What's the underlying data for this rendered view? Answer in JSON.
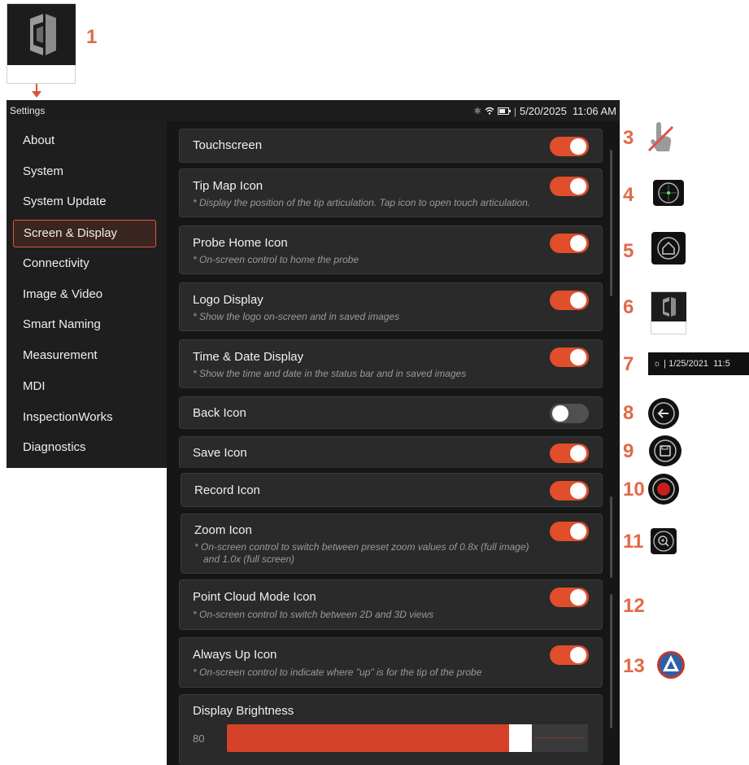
{
  "callouts": [
    "1",
    "3",
    "4",
    "5",
    "6",
    "7",
    "8",
    "9",
    "10",
    "11",
    "12",
    "13"
  ],
  "status_bar": {
    "title": "Settings",
    "icons": [
      "bluetooth-icon",
      "wifi-icon",
      "battery-icon"
    ],
    "datetime": "5/20/2025  11:06 AM"
  },
  "sidebar": {
    "items": [
      {
        "label": "About"
      },
      {
        "label": "System"
      },
      {
        "label": "System Update"
      },
      {
        "label": "Screen & Display",
        "selected": true
      },
      {
        "label": "Connectivity"
      },
      {
        "label": "Image & Video"
      },
      {
        "label": "Smart Naming"
      },
      {
        "label": "Measurement"
      },
      {
        "label": "MDI"
      },
      {
        "label": "InspectionWorks"
      },
      {
        "label": "Diagnostics"
      }
    ]
  },
  "settings": [
    {
      "title": "Touchscreen",
      "on": true
    },
    {
      "title": "Tip Map Icon",
      "desc": "* Display the position of the tip articulation. Tap icon to open touch articulation.",
      "on": true
    },
    {
      "title": "Probe Home Icon",
      "desc": "* On-screen control to home the probe",
      "on": true
    },
    {
      "title": "Logo Display",
      "desc": "* Show the logo on-screen and in saved images",
      "on": true
    },
    {
      "title": "Time & Date Display",
      "desc": "* Show the time and date in the status bar and in saved images",
      "on": true
    },
    {
      "title": "Back Icon",
      "on": false
    },
    {
      "title": "Save Icon",
      "on": true
    },
    {
      "title": "Record Icon",
      "on": true
    },
    {
      "title": "Zoom Icon",
      "desc": "* On-screen control to switch between preset zoom values of 0.8x (full image)",
      "desc2": "and 1.0x (full screen)",
      "on": true
    },
    {
      "title": "Point Cloud Mode Icon",
      "desc": "* On-screen control to switch between 2D and 3D views",
      "on": true
    },
    {
      "title": "Always Up Icon",
      "desc": "* On-screen control to indicate where \"up\" is for the tip of the probe",
      "on": true
    }
  ],
  "brightness": {
    "title": "Display Brightness",
    "value": "80",
    "level": 0.8
  },
  "side_examples": {
    "datetime_example": "1/25/2021  11:5"
  },
  "colors": {
    "accent": "#e04e2c",
    "callout": "#e06a4a",
    "panel": "#2a2a2a",
    "background": "#161616"
  }
}
